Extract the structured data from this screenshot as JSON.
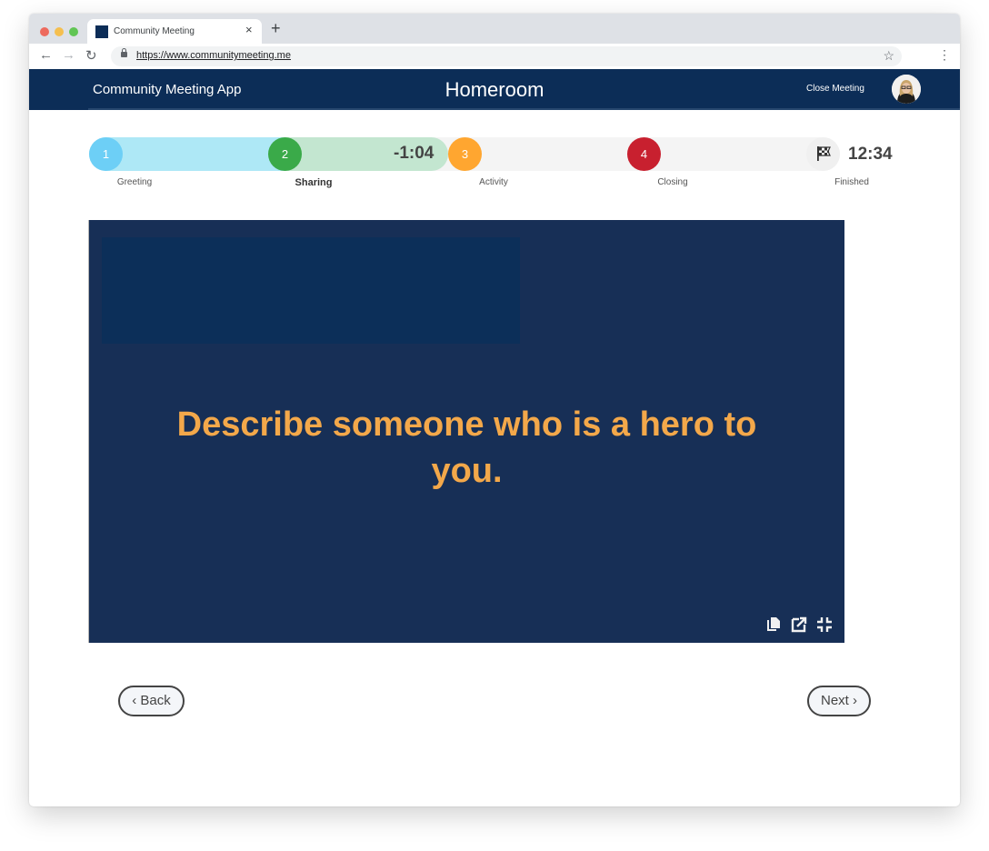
{
  "browser": {
    "tab_title": "Community Meeting",
    "tab_close_icon": "×",
    "new_tab_icon": "+",
    "url": "https://www.communitymeeting.me",
    "back_icon": "←",
    "forward_icon": "→",
    "reload_icon": "↻",
    "bookmark_icon": "☆",
    "menu_icon": "⋮"
  },
  "header": {
    "app_name": "Community Meeting App",
    "room_title": "Homeroom",
    "close_meeting_label": "Close Meeting"
  },
  "agenda": {
    "overtime": "-1:04",
    "total_time": "12:34",
    "current_step": 2,
    "steps": [
      {
        "number": "1",
        "label": "Greeting",
        "color": "#6dcff6"
      },
      {
        "number": "2",
        "label": "Sharing",
        "color": "#3aaa49"
      },
      {
        "number": "3",
        "label": "Activity",
        "color": "#ffa630"
      },
      {
        "number": "4",
        "label": "Closing",
        "color": "#c8202f"
      },
      {
        "number": "flag",
        "label": "Finished",
        "color": "#f0f0f0"
      }
    ]
  },
  "slide": {
    "prompt": "Describe someone who is a hero to you.",
    "tools": [
      "copy-icon",
      "open-external-icon",
      "exit-fullscreen-icon"
    ]
  },
  "navigation": {
    "back_label": "‹ Back",
    "next_label": "Next ›"
  },
  "colors": {
    "brand_navy": "#0c2d57",
    "slide_bg": "#172f56",
    "prompt_text": "#f3a84a"
  }
}
